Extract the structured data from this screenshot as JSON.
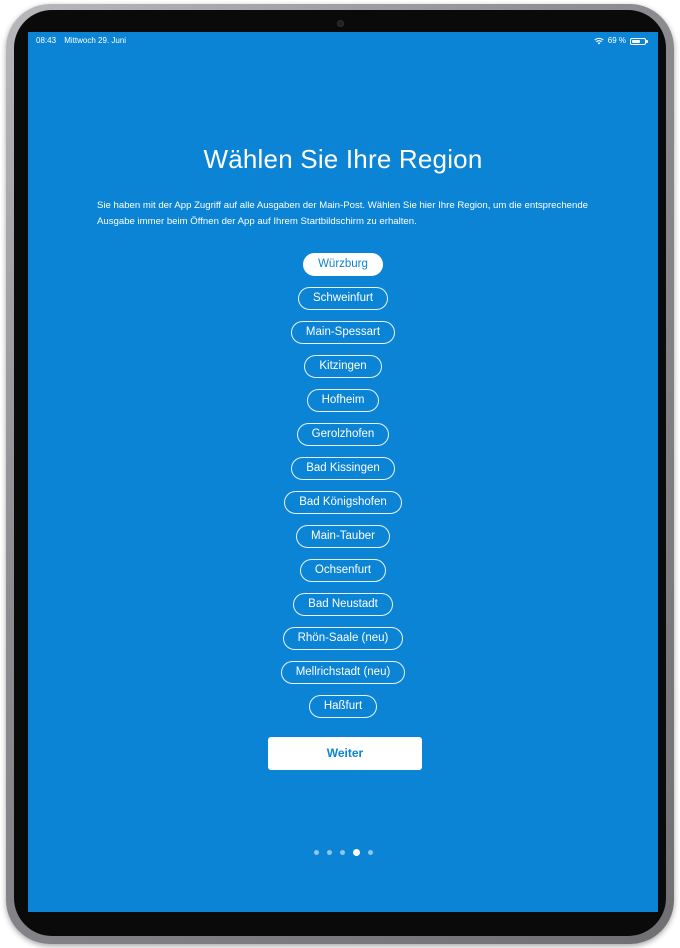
{
  "status_bar": {
    "time": "08:43",
    "date": "Mittwoch 29. Juni",
    "battery_text": "69 %",
    "battery_level": 0.69,
    "wifi_icon": "wifi-icon",
    "battery_icon": "battery-icon"
  },
  "page": {
    "title": "Wählen Sie Ihre Region",
    "intro": "Sie haben mit der App Zugriff auf alle Ausgaben der Main-Post. Wählen Sie hier Ihre Region, um die entsprechende Ausgabe immer beim Öffnen der App auf Ihrem Startbildschirm zu erhalten."
  },
  "regions": [
    {
      "label": "Würzburg",
      "selected": true
    },
    {
      "label": "Schweinfurt",
      "selected": false
    },
    {
      "label": "Main-Spessart",
      "selected": false
    },
    {
      "label": "Kitzingen",
      "selected": false
    },
    {
      "label": "Hofheim",
      "selected": false
    },
    {
      "label": "Gerolzhofen",
      "selected": false
    },
    {
      "label": "Bad Kissingen",
      "selected": false
    },
    {
      "label": "Bad Königshofen",
      "selected": false
    },
    {
      "label": "Main-Tauber",
      "selected": false
    },
    {
      "label": "Ochsenfurt",
      "selected": false
    },
    {
      "label": "Bad Neustadt",
      "selected": false
    },
    {
      "label": "Rhön-Saale (neu)",
      "selected": false
    },
    {
      "label": "Mellrichstadt (neu)",
      "selected": false
    },
    {
      "label": "Haßfurt",
      "selected": false
    }
  ],
  "actions": {
    "continue_label": "Weiter"
  },
  "pager": {
    "total": 5,
    "current": 4
  },
  "colors": {
    "background": "#0c84d6",
    "accent": "#ffffff"
  }
}
